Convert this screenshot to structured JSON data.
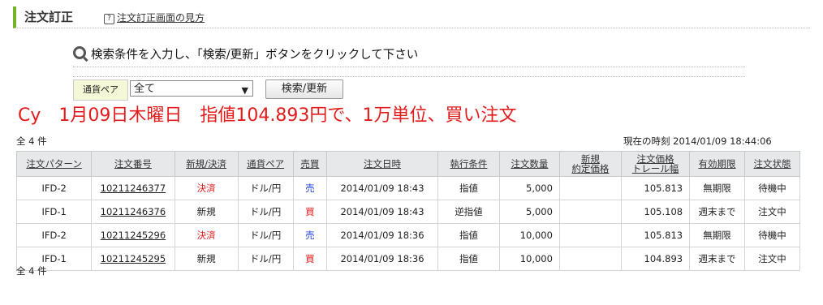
{
  "header": {
    "title": "注文訂正",
    "help_link": "注文訂正画面の見方",
    "help_icon": "question-icon"
  },
  "instruction": "検索条件を入力し、「検索/更新」ボタンをクリックして下さい",
  "filter": {
    "label": "通貨ペア",
    "selected": "全て",
    "button": "検索/更新"
  },
  "annotation": "Cy　1月09日木曜日　指値104.893円で、1万単位、買い注文",
  "count_text": "全 4 件",
  "clock_text": "現在の時刻 2014/01/09 18:44:06",
  "colors": {
    "accent": "#74b226",
    "sell": "#1b3fd6",
    "buy": "#e31b1b",
    "settle": "#e31b1b"
  },
  "table": {
    "headers": [
      "注文パターン",
      "注文番号",
      "新規/決済",
      "通貨ペア",
      "売買",
      "注文日時",
      "執行条件",
      "注文数量",
      "新規\n約定価格",
      "注文価格\nトレール幅",
      "有効期限",
      "注文状態"
    ],
    "rows": [
      {
        "pattern": "IFD-2",
        "order_no": "10211246377",
        "type": "決済",
        "pair": "ドル/円",
        "side": "売",
        "datetime": "2014/01/09 18:43",
        "condition": "指値",
        "qty": "5,000",
        "fill": "",
        "price": "105.813",
        "expiry": "無期限",
        "status": "待機中"
      },
      {
        "pattern": "IFD-1",
        "order_no": "10211246376",
        "type": "新規",
        "pair": "ドル/円",
        "side": "買",
        "datetime": "2014/01/09 18:43",
        "condition": "逆指値",
        "qty": "5,000",
        "fill": "",
        "price": "105.108",
        "expiry": "週末まで",
        "status": "注文中"
      },
      {
        "pattern": "IFD-2",
        "order_no": "10211245296",
        "type": "決済",
        "pair": "ドル/円",
        "side": "売",
        "datetime": "2014/01/09 18:36",
        "condition": "指値",
        "qty": "10,000",
        "fill": "",
        "price": "105.813",
        "expiry": "無期限",
        "status": "待機中"
      },
      {
        "pattern": "IFD-1",
        "order_no": "10211245295",
        "type": "新規",
        "pair": "ドル/円",
        "side": "買",
        "datetime": "2014/01/09 18:36",
        "condition": "指値",
        "qty": "10,000",
        "fill": "",
        "price": "104.893",
        "expiry": "週末まで",
        "status": "注文中"
      }
    ]
  }
}
